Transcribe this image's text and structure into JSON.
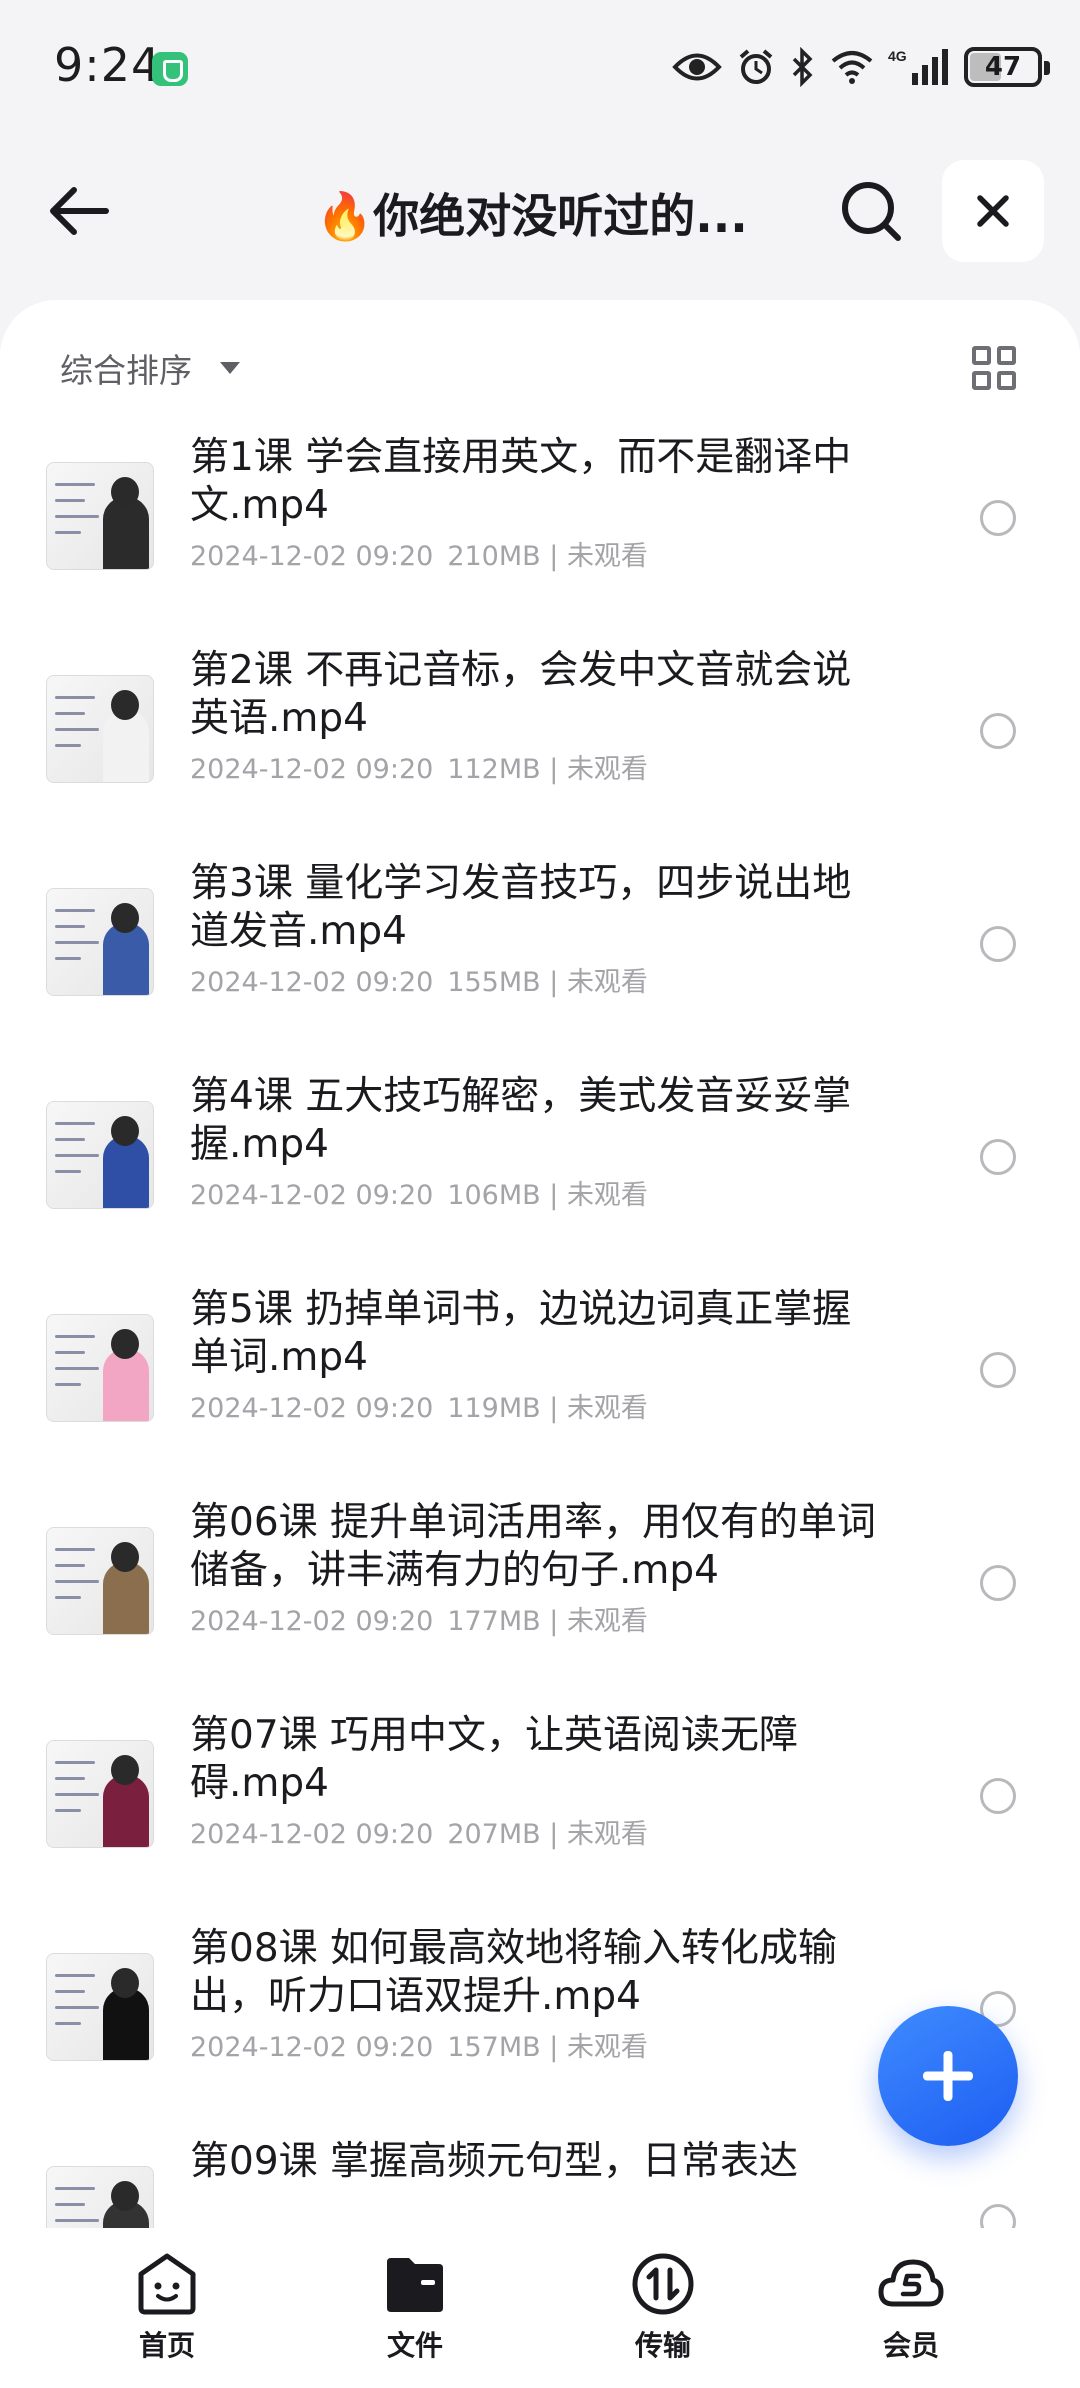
{
  "status_bar": {
    "time": "9:24",
    "battery": "47",
    "network": "4G",
    "icons": [
      "vpn-shield-icon",
      "eye-icon",
      "alarm-icon",
      "bluetooth-icon",
      "wifi-icon",
      "signal-icon",
      "battery-icon"
    ]
  },
  "header": {
    "title": "🔥你绝对没听过的...",
    "icons": [
      "back-arrow-icon",
      "search-icon",
      "close-icon"
    ]
  },
  "toolbar": {
    "sort_label": "综合排序"
  },
  "files": [
    {
      "name": "第1课 学会直接用英文，而不是翻译中文.mp4",
      "date": "2024-12-02 09:20",
      "size": "210MB",
      "status": "未观看"
    },
    {
      "name": "第2课 不再记音标，会发中文音就会说英语.mp4",
      "date": "2024-12-02 09:20",
      "size": "112MB",
      "status": "未观看"
    },
    {
      "name": "第3课 量化学习发音技巧，四步说出地道发音.mp4",
      "date": "2024-12-02 09:20",
      "size": "155MB",
      "status": "未观看"
    },
    {
      "name": "第4课 五大技巧解密，美式发音妥妥掌握.mp4",
      "date": "2024-12-02 09:20",
      "size": "106MB",
      "status": "未观看"
    },
    {
      "name": "第5课 扔掉单词书，边说边词真正掌握单词.mp4",
      "date": "2024-12-02 09:20",
      "size": "119MB",
      "status": "未观看"
    },
    {
      "name": "第06课 提升单词活用率，用仅有的单词储备，讲丰满有力的句子.mp4",
      "date": "2024-12-02 09:20",
      "size": "177MB",
      "status": "未观看"
    },
    {
      "name": "第07课 巧用中文，让英语阅读无障碍.mp4",
      "date": "2024-12-02 09:20",
      "size": "207MB",
      "status": "未观看"
    },
    {
      "name": "第08课 如何最高效地将输入转化成输出，听力口语双提升.mp4",
      "date": "2024-12-02 09:20",
      "size": "157MB",
      "status": "未观看"
    },
    {
      "name": "第09课 掌握高频元句型，日常表达",
      "date": "",
      "size": "",
      "status": ""
    }
  ],
  "bottom_nav": [
    {
      "label": "首页",
      "icon": "home-face-icon"
    },
    {
      "label": "文件",
      "icon": "folder-icon"
    },
    {
      "label": "传输",
      "icon": "transfer-icon"
    },
    {
      "label": "会员",
      "icon": "cloud-vip-icon"
    }
  ],
  "colors": {
    "accent": "#1d5df2",
    "background": "#f4f4f6",
    "meta_text": "#a3a3a8"
  }
}
